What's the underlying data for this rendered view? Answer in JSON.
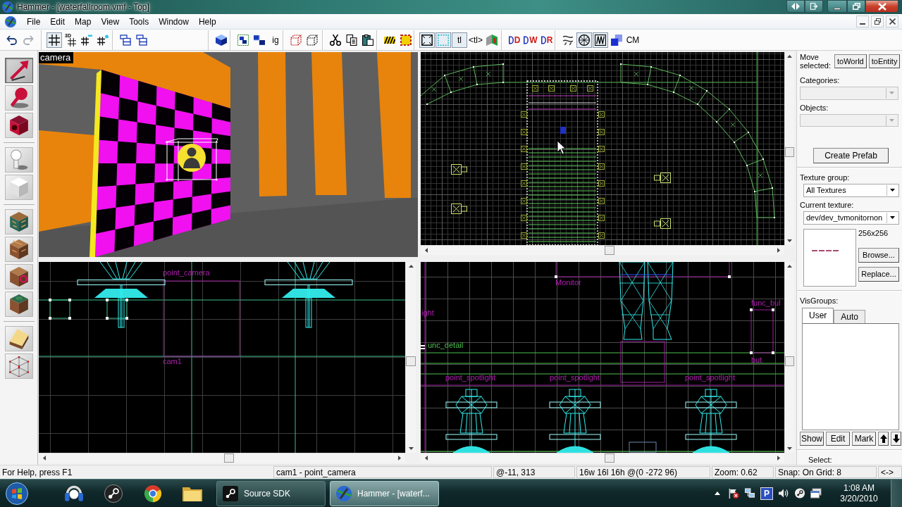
{
  "window": {
    "title": "Hammer - [waterfallroom.vmf - Top]"
  },
  "menu": [
    "File",
    "Edit",
    "Map",
    "View",
    "Tools",
    "Window",
    "Help"
  ],
  "toolbar": [
    [
      {
        "on": false
      },
      {
        "on": false
      }
    ],
    [
      {
        "on": true
      },
      {
        "label": "3D",
        "on": false
      },
      {
        "on": false
      },
      {
        "on": false
      }
    ],
    [
      {
        "on": false
      },
      {
        "on": false
      }
    ],
    [
      {
        "on": false
      }
    ],
    [
      {
        "on": false
      },
      {
        "on": false
      },
      {
        "label": "ig",
        "on": false
      }
    ],
    [
      {
        "on": false
      },
      {
        "on": false
      }
    ],
    [
      {
        "on": false
      },
      {
        "on": false
      },
      {
        "on": false
      }
    ],
    [
      {
        "on": false
      },
      {
        "on": false
      }
    ],
    [
      {
        "on": true
      },
      {
        "on": true
      },
      {
        "label": "tl",
        "on": true
      },
      {
        "label": "<tl>",
        "on": false
      },
      {
        "on": false
      }
    ],
    [
      {
        "label": "D",
        "on": false
      },
      {
        "label": "W",
        "on": false
      },
      {
        "label": "R",
        "on": false
      }
    ],
    [
      {
        "on": false
      },
      {
        "on": true
      },
      {
        "on": true
      },
      {
        "on": false
      },
      {
        "label": "CM",
        "on": false
      }
    ]
  ],
  "tools": [
    [
      {
        "selected": true
      },
      {
        "selected": false
      },
      {
        "selected": false
      }
    ],
    [
      {
        "selected": false
      },
      {
        "selected": false
      }
    ],
    [
      {
        "selected": false
      },
      {
        "selected": false
      },
      {
        "selected": false
      },
      {
        "selected": false
      }
    ],
    [
      {
        "selected": false
      },
      {
        "selected": false
      }
    ]
  ],
  "viewports": {
    "camera": {
      "label": "camera"
    },
    "side": {
      "labels": [
        {
          "text": "point_camera",
          "color": "#b01eb0"
        },
        {
          "text": "cam1",
          "color": "#b01eb0"
        }
      ]
    },
    "front": {
      "labels": [
        {
          "text": "Monitor",
          "color": "#b01eb0"
        },
        {
          "text": "ight",
          "color": "#b01eb0"
        },
        {
          "text": "unc_detail",
          "color": "#4cc04c"
        },
        {
          "text": "func_bul",
          "color": "#b01eb0"
        },
        {
          "text": "but",
          "color": "#b01eb0"
        },
        {
          "text": "point_spotlight",
          "color": "#b01eb0"
        },
        {
          "text": "point_spotlight",
          "color": "#b01eb0"
        },
        {
          "text": "point_spotlight",
          "color": "#b01eb0"
        }
      ]
    }
  },
  "panel": {
    "move_label": "Move selected:",
    "move_buttons": [
      "toWorld",
      "toEntity"
    ],
    "categories": {
      "label": "Categories:",
      "disabled": true
    },
    "objects": {
      "label": "Objects:",
      "disabled": true
    },
    "create_button": "Create Prefab",
    "texture_group": {
      "label": "Texture group:",
      "value": "All Textures",
      "disabled": false
    },
    "current_texture": {
      "label": "Current texture:",
      "value": "dev/dev_tvmonitornon",
      "disabled": false
    },
    "texture_size": "256x256",
    "texture_buttons": [
      "Browse...",
      "Replace..."
    ],
    "visgroups": {
      "label": "VisGroups:",
      "tabs": [
        {
          "label": "User",
          "selected": true
        },
        {
          "label": "Auto",
          "selected": false
        }
      ],
      "buttons": [
        "Show",
        "Edit",
        "Mark"
      ]
    },
    "select_label": "Select:"
  },
  "status_bar": [
    "For Help, press F1",
    "cam1 - point_camera",
    "@-11, 313",
    "16w 16l 16h @(0 -272 96)",
    "Zoom: 0.62",
    "Snap: On Grid: 8",
    "<->"
  ],
  "taskbar": {
    "windows": [
      {
        "label": "Source SDK",
        "selected": false
      },
      {
        "label": "Hammer - [waterf...",
        "selected": true
      }
    ],
    "tray_badge": "P",
    "time": "1:08 AM",
    "date": "3/20/2010"
  }
}
